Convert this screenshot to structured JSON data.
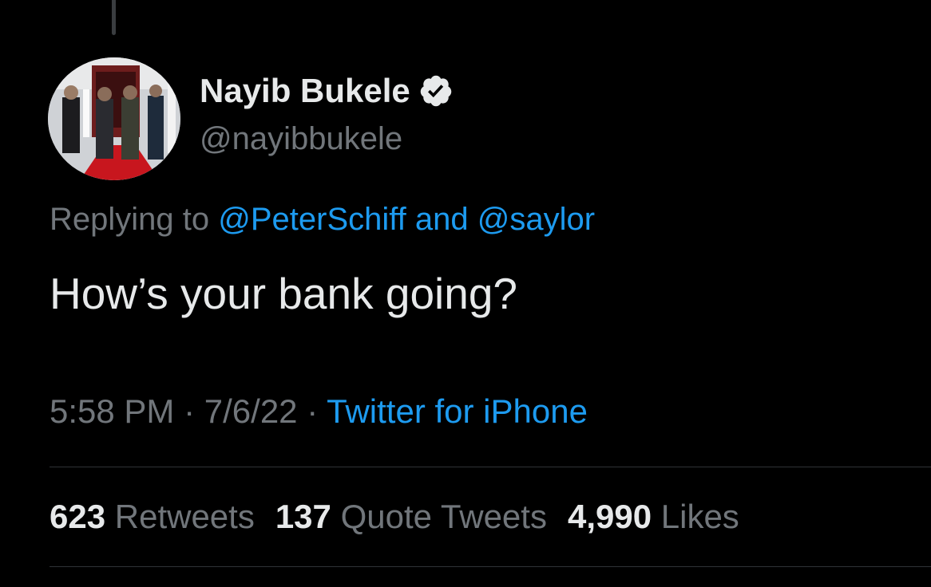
{
  "tweet": {
    "author": {
      "display_name": "Nayib Bukele",
      "handle": "@nayibbukele",
      "verified_icon": "verified-badge-icon"
    },
    "reply": {
      "prefix": "Replying to",
      "mention_1": "@PeterSchiff",
      "joiner": "and",
      "mention_2": "@saylor"
    },
    "text": "How’s your bank going?",
    "meta": {
      "time": "5:58 PM",
      "separator_1": "·",
      "date": "7/6/22",
      "separator_2": "·",
      "source": "Twitter for iPhone"
    },
    "stats": [
      {
        "count": "623",
        "label": "Retweets"
      },
      {
        "count": "137",
        "label": "Quote Tweets"
      },
      {
        "count": "4,990",
        "label": "Likes"
      }
    ]
  },
  "colors": {
    "background": "#000000",
    "primary_text": "#e7e9ea",
    "secondary_text": "#71767b",
    "link": "#1d9bf0",
    "divider": "#2f3336"
  }
}
